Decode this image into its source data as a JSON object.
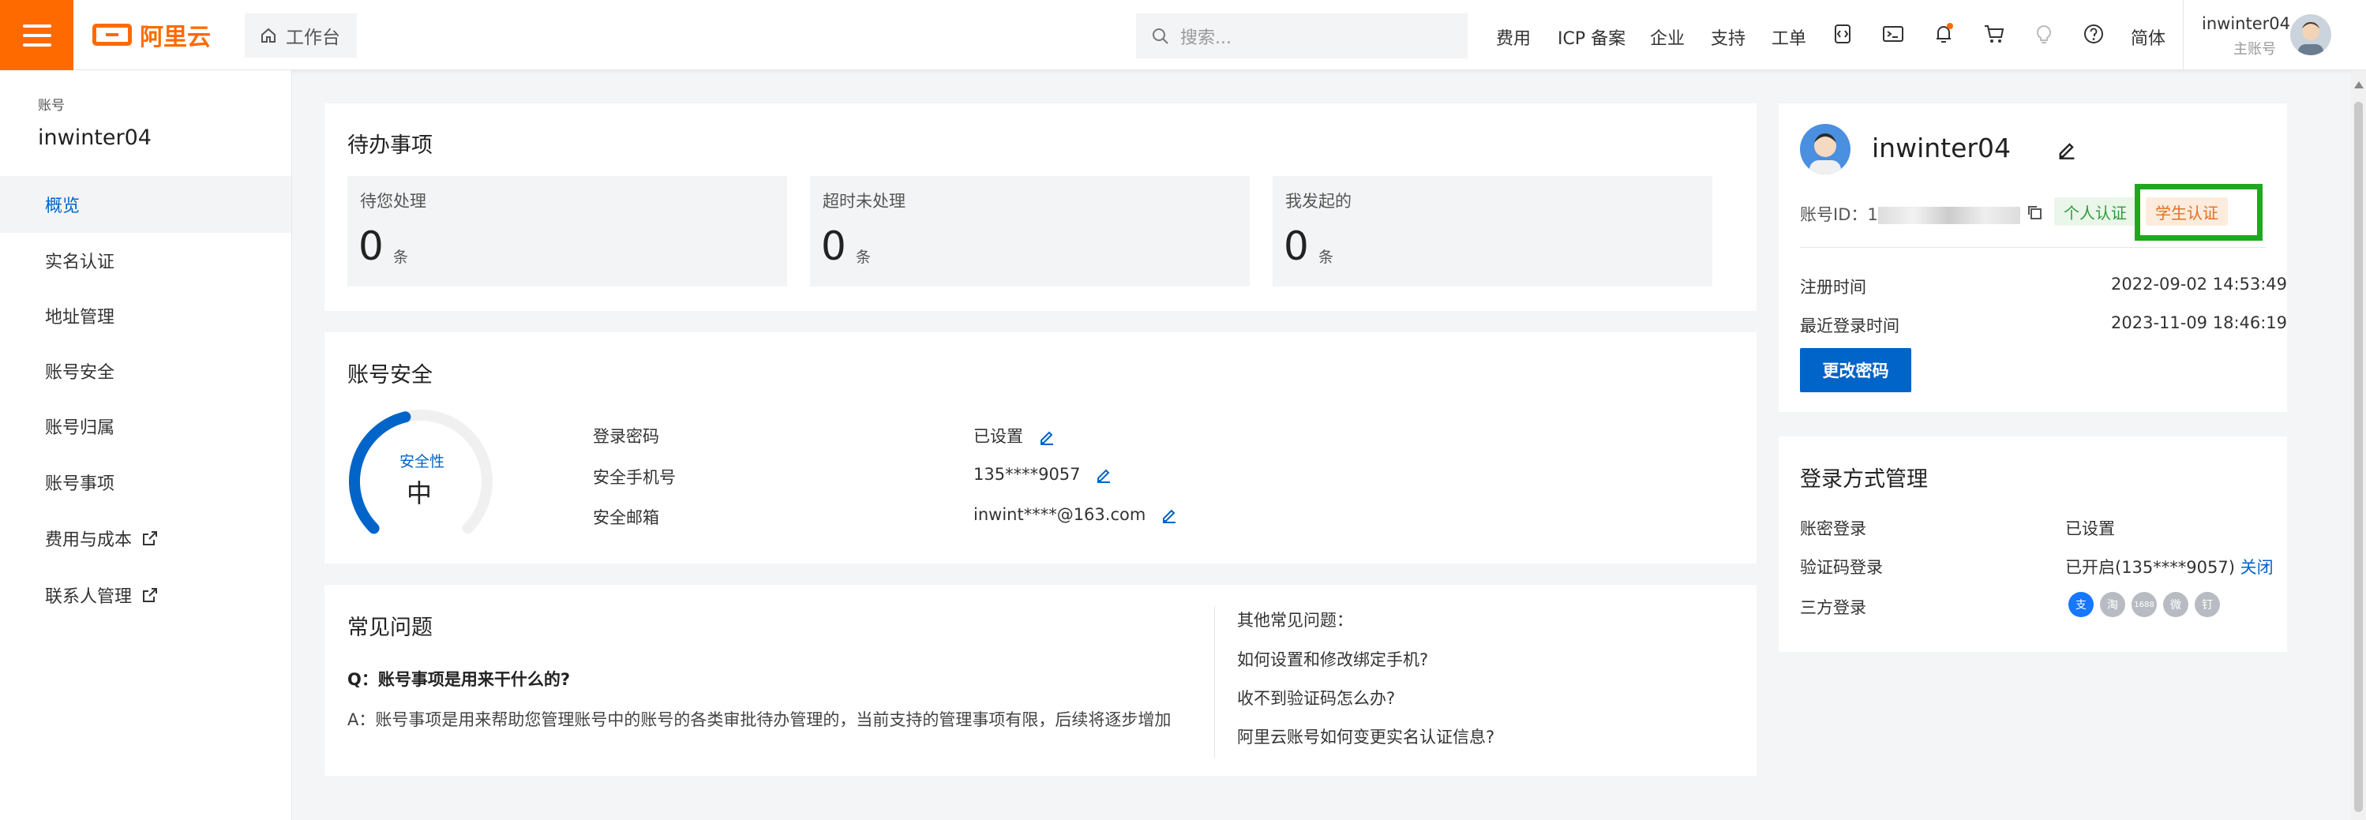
{
  "topbar": {
    "logo_text": "阿里云",
    "workbench": "工作台",
    "search_placeholder": "搜索...",
    "links": [
      "费用",
      "ICP 备案",
      "企业",
      "支持",
      "工单"
    ],
    "lang": "简体",
    "user_name": "inwinter04",
    "user_role": "主账号",
    "icons": [
      "menu-icon",
      "home-icon",
      "search-icon",
      "code-icon",
      "terminal-icon",
      "bell-icon",
      "cart-icon",
      "bulb-icon",
      "help-icon"
    ]
  },
  "sidebar": {
    "label": "账号",
    "name": "inwinter04",
    "items": [
      "概览",
      "实名认证",
      "地址管理",
      "账号安全",
      "账号归属",
      "账号事项",
      "费用与成本",
      "联系人管理"
    ]
  },
  "todo": {
    "title": "待办事项",
    "boxes": [
      {
        "label": "待您处理",
        "count": "0",
        "unit": "条"
      },
      {
        "label": "超时未处理",
        "count": "0",
        "unit": "条"
      },
      {
        "label": "我发起的",
        "count": "0",
        "unit": "条"
      }
    ]
  },
  "security": {
    "title": "账号安全",
    "gauge_label": "安全性",
    "gauge_level": "中",
    "gauge_fraction": 0.45,
    "rows": [
      {
        "label": "登录密码",
        "value": "已设置"
      },
      {
        "label": "安全手机号",
        "value": "135****9057"
      },
      {
        "label": "安全邮箱",
        "value": "inwint****@163.com"
      }
    ]
  },
  "faq": {
    "title": "常见问题",
    "question": "Q：账号事项是用来干什么的?",
    "answer": "A：账号事项是用来帮助您管理账号中的账号的各类审批待办管理的，当前支持的管理事项有限，后续将逐步增加",
    "other_title": "其他常见问题：",
    "others": [
      "如何设置和修改绑定手机?",
      "收不到验证码怎么办?",
      "阿里云账号如何变更实名认证信息?"
    ]
  },
  "profile": {
    "name": "inwinter04",
    "id_label": "账号ID：1",
    "tag_personal": "个人认证",
    "tag_student": "学生认证",
    "reg_label": "注册时间",
    "reg_value": "2022-09-02 14:53:49",
    "last_label": "最近登录时间",
    "last_value": "2023-11-09 18:46:19",
    "change_pwd": "更改密码"
  },
  "login_mgmt": {
    "title": "登录方式管理",
    "rows": [
      {
        "label": "账密登录",
        "value": "已设置"
      },
      {
        "label": "验证码登录",
        "value": "已开启(135****9057)",
        "action": "关闭"
      },
      {
        "label": "三方登录",
        "value": ""
      }
    ],
    "social_icons": [
      "alipay-icon",
      "taobao-icon",
      "1688-icon",
      "weibo-icon",
      "dingtalk-icon"
    ]
  },
  "colors": {
    "brand": "#ff6a00",
    "primary": "#0064c8",
    "highlight_box": "#1fa81f"
  }
}
